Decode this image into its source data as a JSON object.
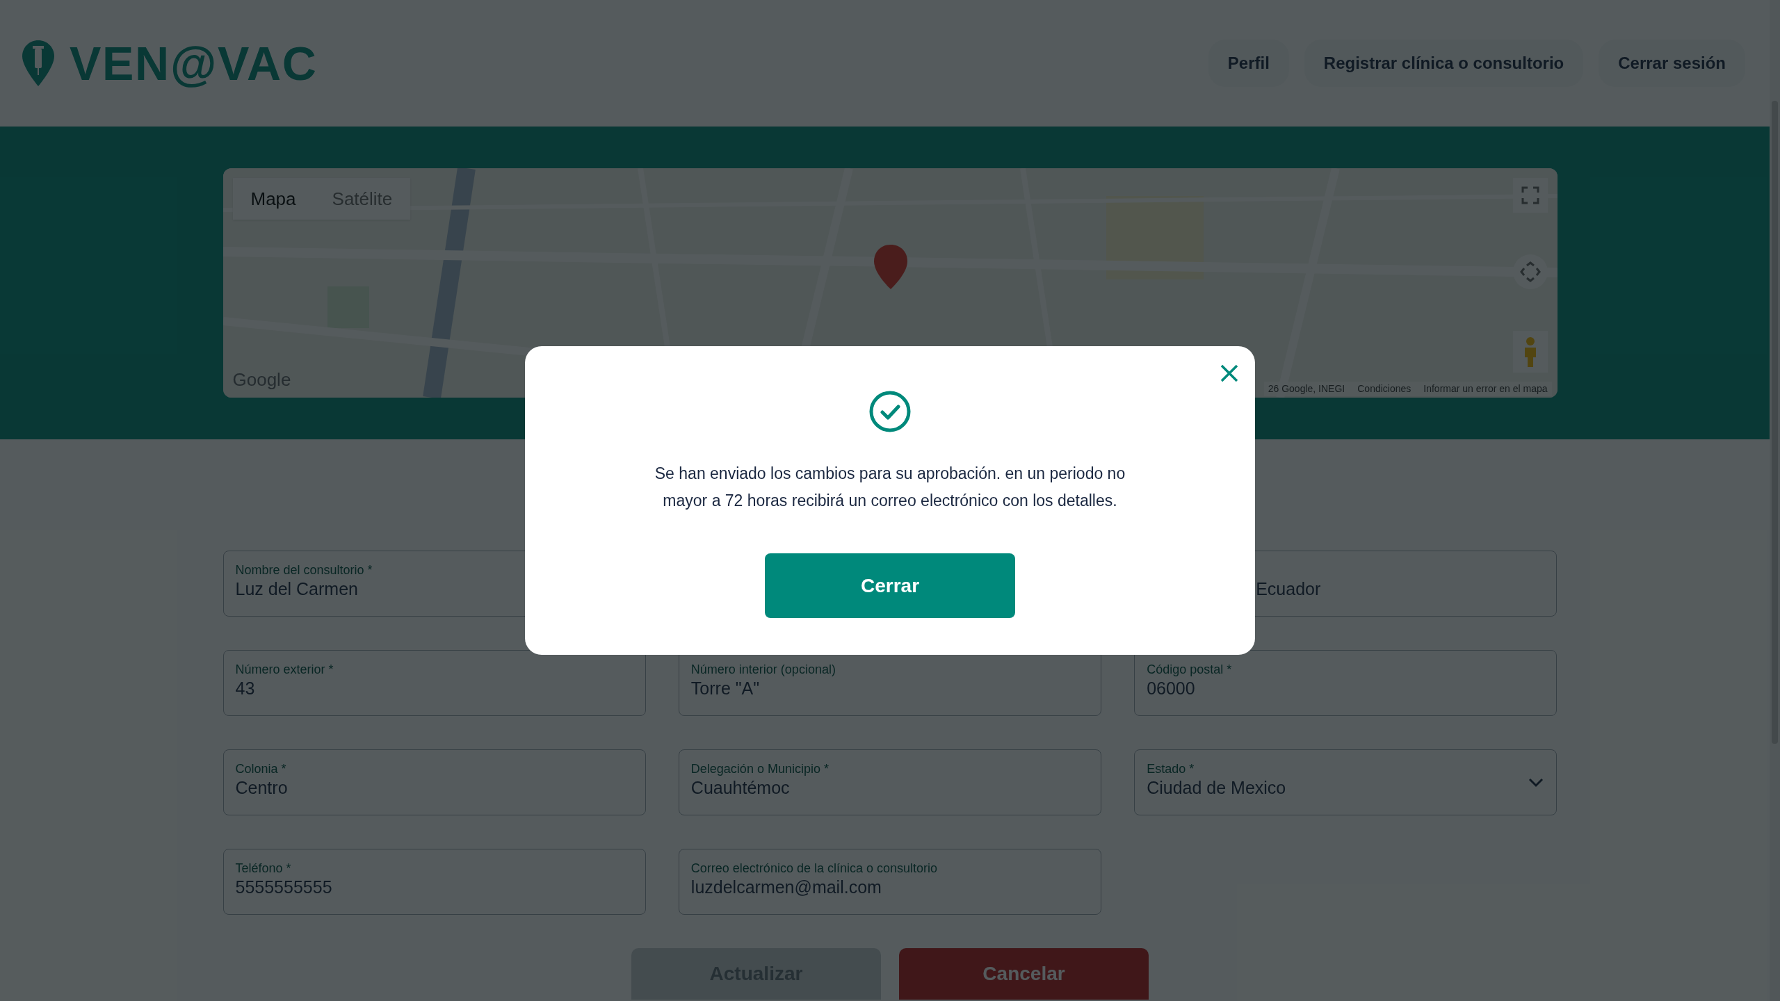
{
  "header": {
    "logo": "VEN@VAC",
    "nav": [
      "Perfil",
      "Registrar clínica o consultorio",
      "Cerrar sesión"
    ]
  },
  "map": {
    "view_tabs": [
      {
        "label": "Mapa",
        "selected": true
      },
      {
        "label": "Satélite",
        "selected": false
      }
    ],
    "logo": "Google",
    "attribution": [
      "26 Google, INEGI",
      "Condiciones",
      "Informar un error en el mapa"
    ]
  },
  "form": {
    "rows": [
      [
        {
          "kind": "text",
          "label": "Nombre del consultorio *",
          "value": "Luz del Carmen"
        },
        {
          "kind": "covered_text",
          "value": "Ecuador"
        }
      ],
      [
        {
          "kind": "text",
          "label": "Número exterior *",
          "value": "43"
        },
        {
          "kind": "text",
          "label": "Número interior (opcional)",
          "value": "Torre \"A\""
        },
        {
          "kind": "text",
          "label": "Código postal *",
          "value": "06000"
        }
      ],
      [
        {
          "kind": "text",
          "label": "Colonia *",
          "value": "Centro"
        },
        {
          "kind": "text",
          "label": "Delegación o Municipio *",
          "value": "Cuauhtémoc"
        },
        {
          "kind": "select",
          "label": "Estado *",
          "value": "Ciudad de Mexico"
        }
      ],
      [
        {
          "kind": "text",
          "label": "Teléfono *",
          "value": "5555555555"
        },
        {
          "kind": "text",
          "label": "Correo electrónico de la clínica o consultorio",
          "value": "luzdelcarmen@mail.com"
        }
      ]
    ],
    "buttons": [
      {
        "kind": "submit",
        "label": "Actualizar",
        "disabled": true
      },
      {
        "kind": "cancel",
        "label": "Cancelar",
        "disabled": false
      }
    ]
  },
  "modal": {
    "message": "Se han enviado los cambios para su aprobación. en un periodo no mayor a 72 horas recibirá un correo electrónico con los detalles.",
    "button": "Cerrar"
  }
}
